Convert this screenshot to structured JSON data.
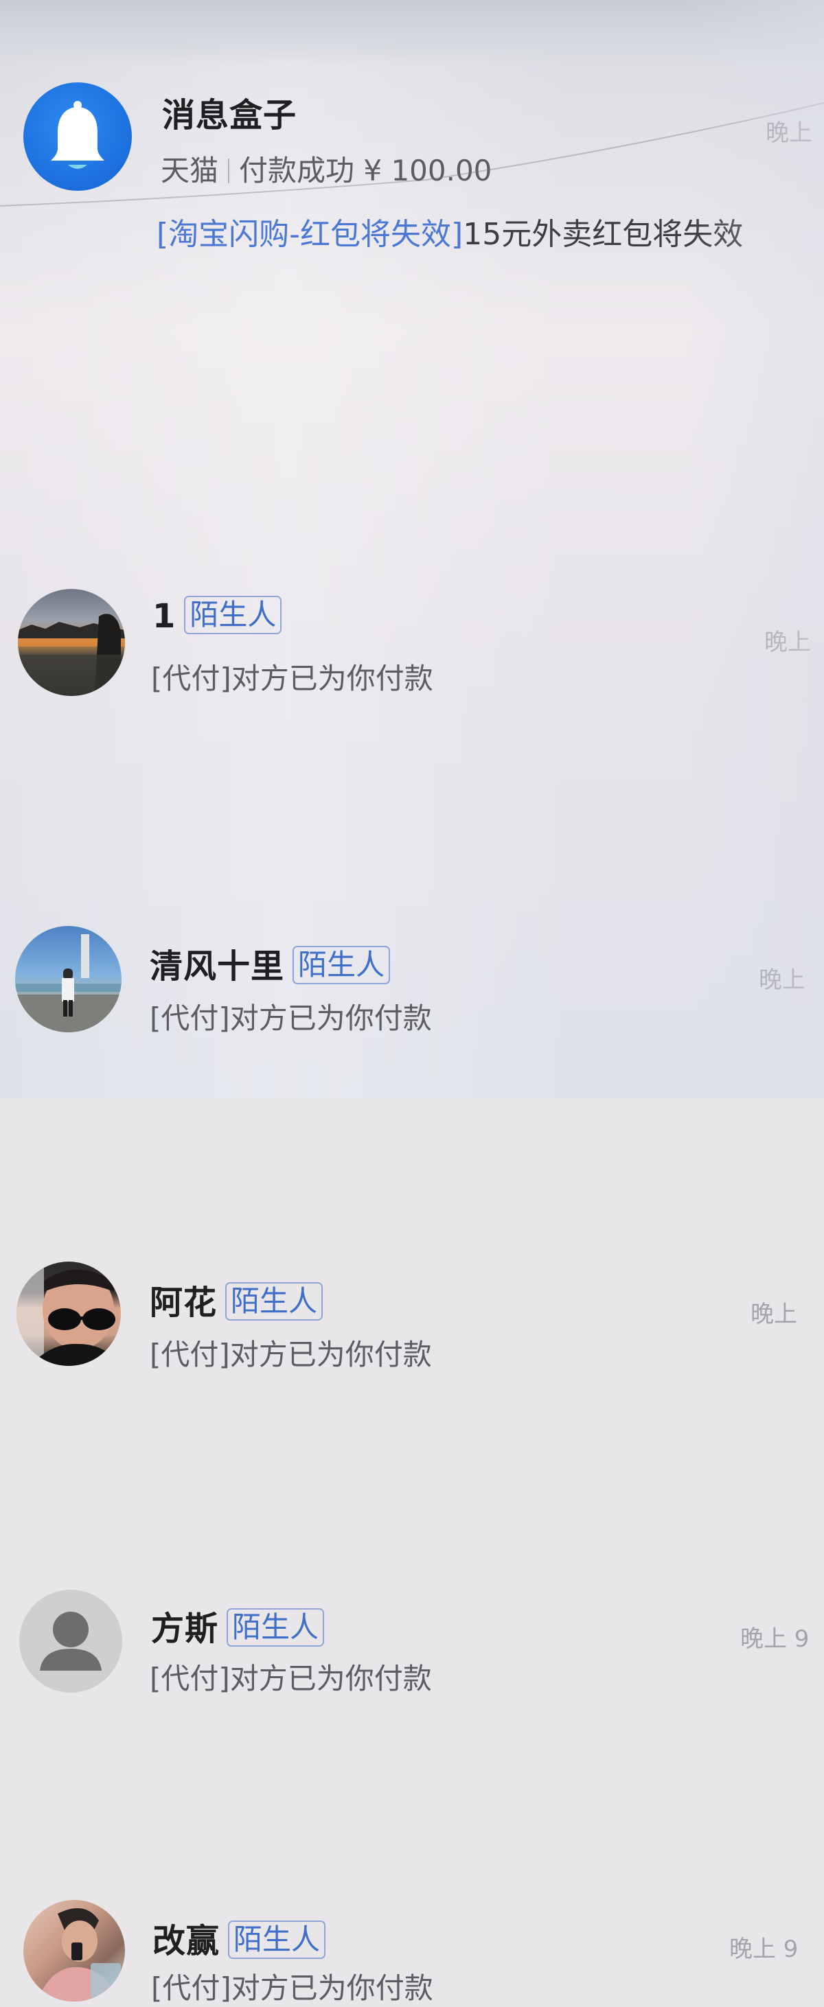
{
  "inbox": {
    "title": "消息盒子",
    "subtitle_source": "天猫",
    "subtitle_text": "付款成功 ¥ 100.00",
    "promo_tag": "[淘宝闪购-红包将失效]",
    "promo_text": "15元外卖红包将失效",
    "time": "晚上",
    "icon": "bell-icon",
    "icon_color": "#1b6fdd"
  },
  "contacts": [
    {
      "name": "1",
      "badge": "陌生人",
      "preview": "[代付]对方已为你付款",
      "time": "晚上"
    },
    {
      "name": "清风十里",
      "badge": "陌生人",
      "preview": "[代付]对方已为你付款",
      "time": "晚上"
    },
    {
      "name": "阿花",
      "badge": "陌生人",
      "preview": "[代付]对方已为你付款",
      "time": "晚上"
    },
    {
      "name": "方斯",
      "badge": "陌生人",
      "preview": "[代付]对方已为你付款",
      "time": "晚上 9"
    },
    {
      "name": "改赢",
      "badge": "陌生人",
      "preview": "[代付]对方已为你付款",
      "time": "晚上 9"
    }
  ],
  "colors": {
    "badge_border": "#8ea7d8",
    "badge_text": "#3f6fc8",
    "promo_tag": "#4a78d2"
  }
}
